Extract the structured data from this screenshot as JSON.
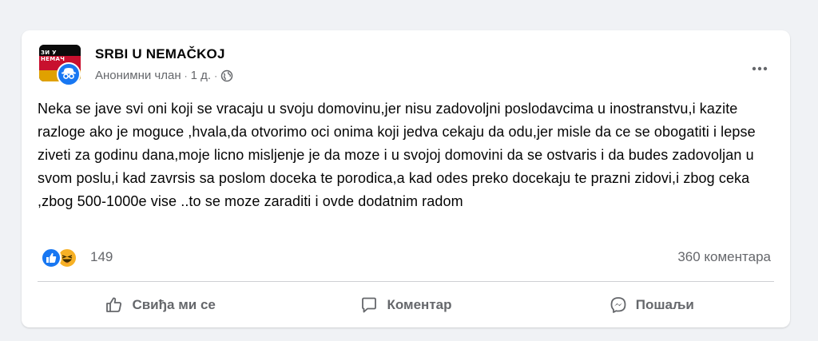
{
  "post": {
    "group_name": "SRBI U NEMAČKOJ",
    "author": "Анонимни члан",
    "separator": "·",
    "time": "1 д.",
    "text": "Neka se jave svi oni koji se vracaju u svoju domovinu,jer nisu zadovoljni poslodavcima u inostranstvu,i kazite razloge ako je moguce ,hvala,da otvorimo oci onima koji jedva cekaju da odu,jer misle da ce se obogatiti i lepse ziveti za godinu dana,moje licno misljenje je da moze i u svojoj domovini da se ostvaris i da budes zadovoljan u svom poslu,i kad zavrsis sa poslom doceka te porodica,a kad odes preko docekaju te prazni zidovi,i zbog ceka ,zbog 500-1000e vise ..to se moze zaraditi i ovde dodatnim radom",
    "avatar_text": "ЗИ У НЕМАЧ"
  },
  "reactions": {
    "icons": [
      "like-icon",
      "haha-icon"
    ],
    "count": "149",
    "comments": "360 коментара"
  },
  "actions": {
    "like_label": "Свиђа ми се",
    "comment_label": "Коментар",
    "share_label": "Пошаљи"
  },
  "colors": {
    "accent": "#1877f2",
    "secondary_text": "#65676b",
    "haha": "#f7b125"
  }
}
